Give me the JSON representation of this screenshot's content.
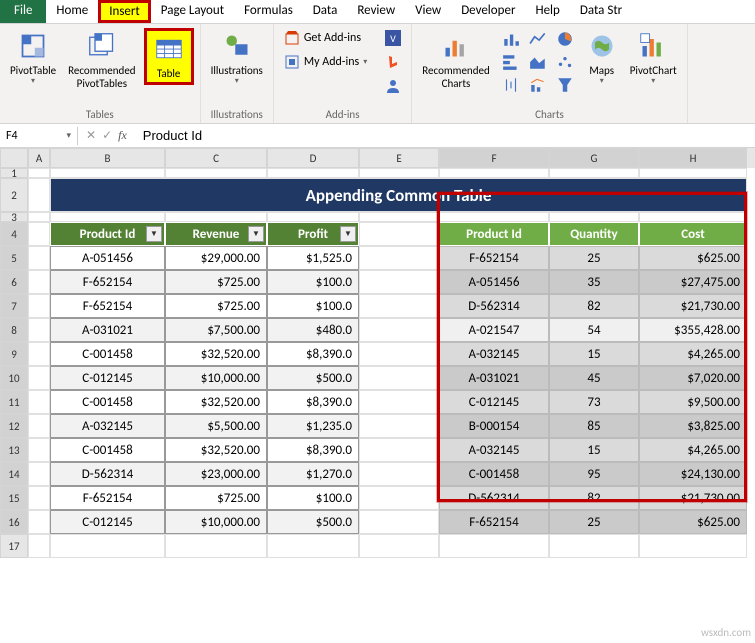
{
  "tabs": {
    "file": "File",
    "home": "Home",
    "insert": "Insert",
    "page_layout": "Page Layout",
    "formulas": "Formulas",
    "data": "Data",
    "review": "Review",
    "view": "View",
    "developer": "Developer",
    "help": "Help",
    "data_str": "Data Str"
  },
  "ribbon": {
    "tables": {
      "pivottable": "PivotTable",
      "recommended_pt": "Recommended\nPivotTables",
      "table": "Table",
      "group": "Tables"
    },
    "illustrations": {
      "btn": "Illustrations",
      "group": "Illustrations"
    },
    "addins": {
      "get": "Get Add-ins",
      "my": "My Add-ins",
      "group": "Add-ins"
    },
    "charts": {
      "recommended": "Recommended\nCharts",
      "maps": "Maps",
      "pivotchart": "PivotChart",
      "group": "Charts"
    }
  },
  "namebox": "F4",
  "formula": "Product Id",
  "cols": [
    "A",
    "B",
    "C",
    "D",
    "E",
    "F",
    "G",
    "H"
  ],
  "rows": [
    "1",
    "2",
    "3",
    "4",
    "5",
    "6",
    "7",
    "8",
    "9",
    "10",
    "11",
    "12",
    "13",
    "14",
    "15",
    "16",
    "17"
  ],
  "banner": "Appending Common Table",
  "left_table": {
    "headers": [
      "Product Id",
      "Revenue",
      "Profit"
    ],
    "rows": [
      [
        "A-051456",
        "$29,000.00",
        "$1,525.0"
      ],
      [
        "F-652154",
        "$725.00",
        "$100.0"
      ],
      [
        "F-652154",
        "$725.00",
        "$100.0"
      ],
      [
        "A-031021",
        "$7,500.00",
        "$480.0"
      ],
      [
        "C-001458",
        "$32,520.00",
        "$8,390.0"
      ],
      [
        "C-012145",
        "$10,000.00",
        "$500.0"
      ],
      [
        "C-001458",
        "$32,520.00",
        "$8,390.0"
      ],
      [
        "A-032145",
        "$5,500.00",
        "$1,235.0"
      ],
      [
        "C-001458",
        "$32,520.00",
        "$8,390.0"
      ],
      [
        "D-562314",
        "$23,000.00",
        "$1,270.0"
      ],
      [
        "F-652154",
        "$725.00",
        "$100.0"
      ],
      [
        "C-012145",
        "$10,000.00",
        "$500.0"
      ]
    ]
  },
  "right_table": {
    "headers": [
      "Product Id",
      "Quantity",
      "Cost"
    ],
    "rows": [
      [
        "F-652154",
        "25",
        "$625.00"
      ],
      [
        "A-051456",
        "35",
        "$27,475.00"
      ],
      [
        "D-562314",
        "82",
        "$21,730.00"
      ],
      [
        "A-021547",
        "54",
        "$355,428.00"
      ],
      [
        "A-032145",
        "15",
        "$4,265.00"
      ],
      [
        "A-031021",
        "45",
        "$7,020.00"
      ],
      [
        "C-012145",
        "73",
        "$9,500.00"
      ],
      [
        "B-000154",
        "85",
        "$3,825.00"
      ],
      [
        "A-032145",
        "15",
        "$4,265.00"
      ],
      [
        "C-001458",
        "95",
        "$24,130.00"
      ],
      [
        "D-562314",
        "82",
        "$21,730.00"
      ],
      [
        "F-652154",
        "25",
        "$625.00"
      ]
    ]
  },
  "watermark": "wsxdn.com"
}
